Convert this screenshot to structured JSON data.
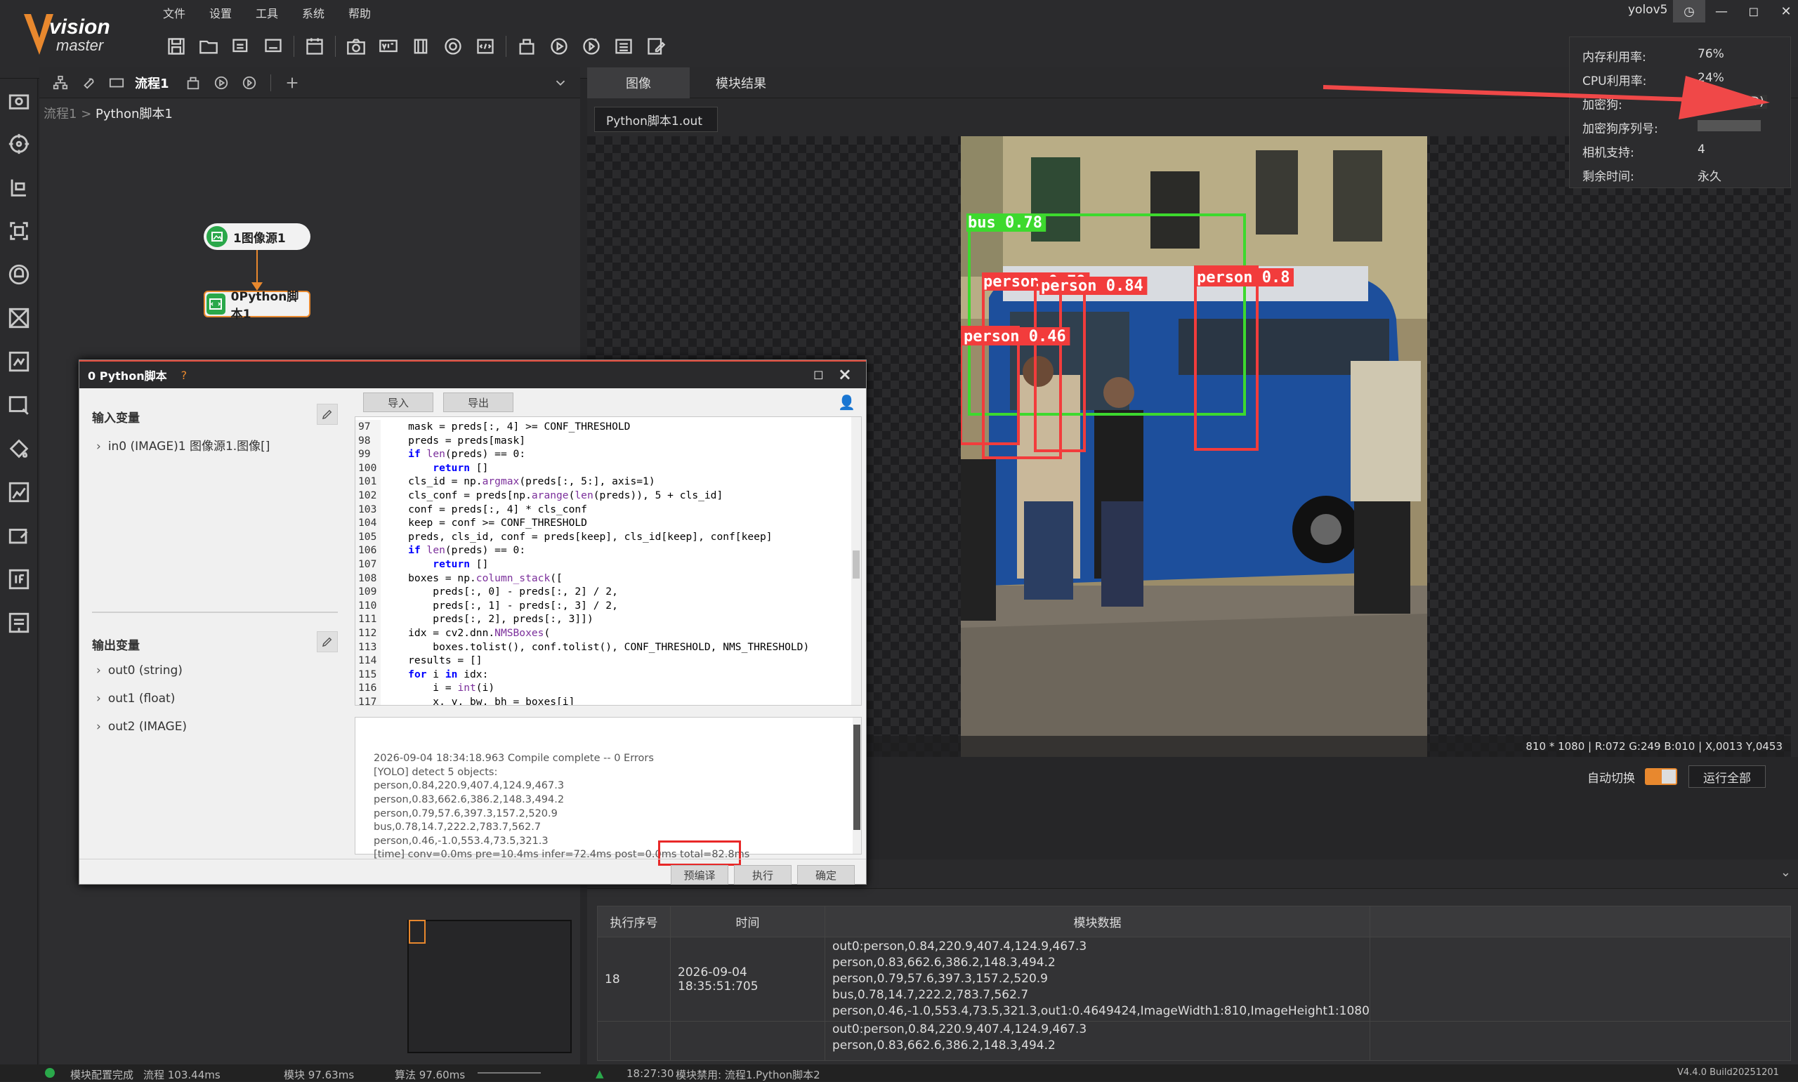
{
  "menu": [
    "文件",
    "设置",
    "工具",
    "系统",
    "帮助"
  ],
  "user": "yolov5",
  "flow": {
    "tab_title": "流程1",
    "breadcrumb_root": "流程1",
    "breadcrumb_sep": ">",
    "breadcrumb_current": "Python脚本1",
    "node1_label": "1图像源1",
    "node2_label": "0Python脚本1"
  },
  "dialog": {
    "title": "0 Python脚本",
    "help": "?",
    "input_header": "输入变量",
    "input_items": [
      "in0 (IMAGE)1 图像源1.图像[]"
    ],
    "output_header": "输出变量",
    "output_items": [
      "out0 (string)",
      "out1 (float)",
      "out2 (IMAGE)"
    ],
    "import_label": "导入",
    "export_label": "导出",
    "line_numbers": [
      "97",
      "98",
      "99",
      "100",
      "101",
      "102",
      "103",
      "104",
      "105",
      "106",
      "107",
      "108",
      "109",
      "110",
      "111",
      "112",
      "113",
      "114",
      "115",
      "116",
      "117"
    ],
    "log_lines": [
      "2026-09-04 18:34:18.963 Compile complete -- 0 Errors",
      "[YOLO] detect 5 objects:",
      "person,0.84,220.9,407.4,124.9,467.3",
      "person,0.83,662.6,386.2,148.3,494.2",
      "person,0.79,57.6,397.3,157.2,520.9",
      "bus,0.78,14.7,222.2,783.7,562.7",
      "person,0.46,-1.0,553.4,73.5,321.3",
      "[time] conv=0.0ms pre=10.4ms infer=72.4ms post=0.0ms total=82.8ms"
    ],
    "precompile_label": "预编译",
    "execute_label": "执行",
    "confirm_label": "确定"
  },
  "image_panel": {
    "tabs": [
      "图像",
      "模块结果"
    ],
    "output_select": "Python脚本1.out",
    "status": "810 * 1080  |  R:072  G:249  B:010  |  X,0013  Y,0453",
    "detections": [
      {
        "label": "bus 0.78",
        "color": "#3dd92e"
      },
      {
        "label": "person 0.79",
        "color": "#f23c3c"
      },
      {
        "label": "person 0.84",
        "color": "#f23c3c"
      },
      {
        "label": "person 0.46",
        "color": "#f23c3c"
      },
      {
        "label": "person 0.8",
        "color": "#f23c3c"
      }
    ]
  },
  "sysinfo": {
    "rows": [
      {
        "k": "内存利用率:",
        "v": "76%"
      },
      {
        "k": "CPU利用率:",
        "v": "24%"
      },
      {
        "k": "加密狗:",
        "v": "6200(STD)"
      },
      {
        "k": "加密狗序列号:",
        "v": ""
      },
      {
        "k": "相机支持:",
        "v": "4"
      },
      {
        "k": "剩余时间:",
        "v": "永久"
      }
    ]
  },
  "controls": {
    "auto_switch": "自动切换",
    "run_all": "运行全部"
  },
  "results": {
    "headers": [
      "执行序号",
      "时间",
      "模块数据"
    ],
    "rows": [
      {
        "idx": "18",
        "time": "2026-09-04 18:35:51:705",
        "data": "out0:person,0.84,220.9,407.4,124.9,467.3\nperson,0.83,662.6,386.2,148.3,494.2\nperson,0.79,57.6,397.3,157.2,520.9\nbus,0.78,14.7,222.2,783.7,562.7\nperson,0.46,-1.0,553.4,73.5,321.3,out1:0.4649424,ImageWidth1:810,ImageHeight1:1080"
      },
      {
        "idx": "",
        "time": "",
        "data": "out0:person,0.84,220.9,407.4,124.9,467.3\nperson,0.83,662.6,386.2,148.3,494.2"
      }
    ]
  },
  "statusbar": {
    "left": "模块配置完成",
    "flow": "流程  103.44ms",
    "module": "模块  97.63ms",
    "algo": "算法  97.60ms",
    "time": "18:27:30",
    "msg": "模块禁用: 流程1.Python脚本2",
    "version": "V4.4.0 Build20251201"
  }
}
